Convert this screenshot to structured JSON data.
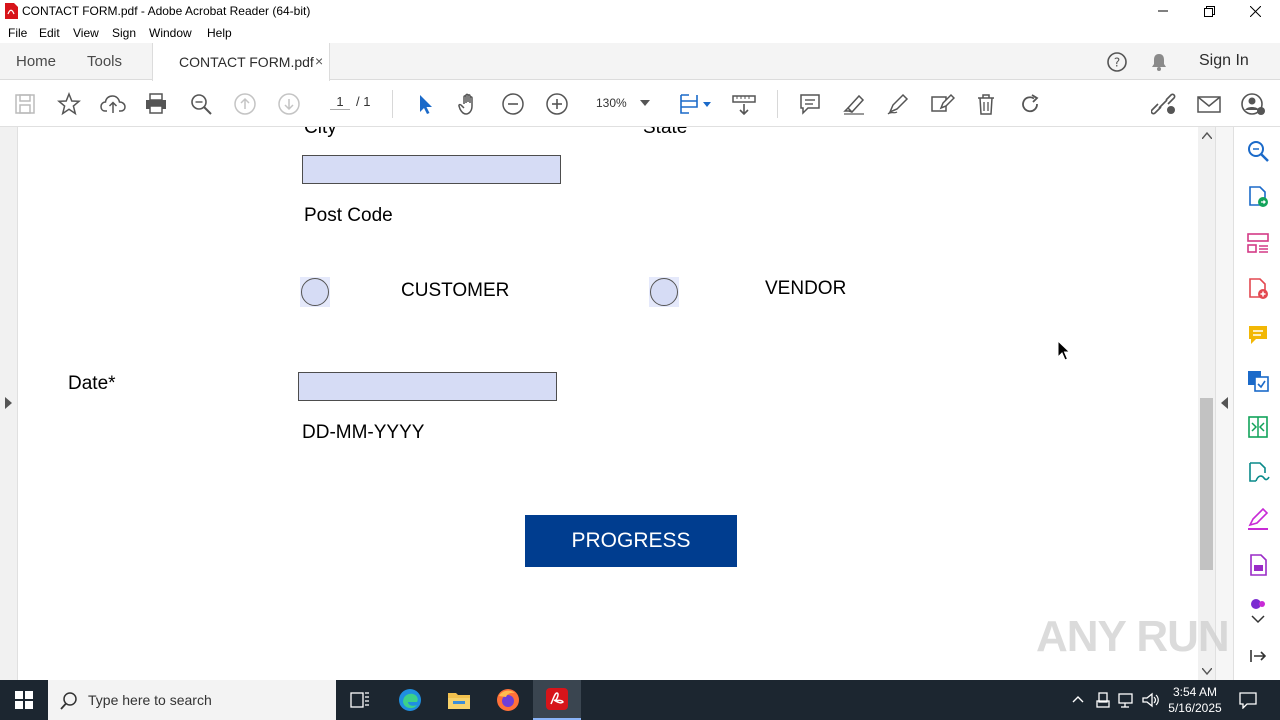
{
  "window": {
    "title": "CONTACT FORM.pdf - Adobe Acrobat Reader (64-bit)"
  },
  "menu": [
    "File",
    "Edit",
    "View",
    "Sign",
    "Window",
    "Help"
  ],
  "tabs": {
    "home": "Home",
    "tools": "Tools",
    "document": "CONTACT FORM.pdf",
    "close": "×"
  },
  "header": {
    "sign_in": "Sign In"
  },
  "toolbar": {
    "page_current": "1",
    "page_total": "/ 1",
    "zoom": "130%"
  },
  "form": {
    "city_label": "City",
    "state_label": "State",
    "post_code_label": "Post Code",
    "customer_label": "CUSTOMER",
    "vendor_label": "VENDOR",
    "date_label": "Date*",
    "date_hint": "DD-MM-YYYY",
    "submit_label": "PROGRESS"
  },
  "watermark": "ANY RUN",
  "taskbar": {
    "search_placeholder": "Type here to search",
    "time": "3:54 AM",
    "date": "5/16/2025"
  },
  "colors": {
    "field_fill": "#d6dcf5",
    "submit_button": "#003d8f",
    "acrobat_red": "#d7141a",
    "taskbar": "#1c2630"
  }
}
